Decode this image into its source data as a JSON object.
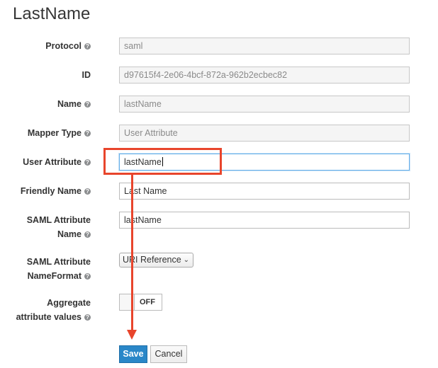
{
  "page": {
    "title": "LastName"
  },
  "fields": {
    "protocol": {
      "label": "Protocol",
      "value": "saml"
    },
    "id": {
      "label": "ID",
      "value": "d97615f4-2e06-4bcf-872a-962b2ecbec82"
    },
    "name": {
      "label": "Name",
      "value": "lastName"
    },
    "mapper_type": {
      "label": "Mapper Type",
      "value": "User Attribute"
    },
    "user_attribute": {
      "label": "User Attribute",
      "value": "lastName"
    },
    "friendly_name": {
      "label": "Friendly Name",
      "value": "Last Name"
    },
    "saml_attribute_name": {
      "label_line1": "SAML Attribute",
      "label_line2": "Name",
      "value": "lastName"
    },
    "saml_attribute_nameformat": {
      "label_line1": "SAML Attribute",
      "label_line2": "NameFormat",
      "selected": "URI Reference"
    },
    "aggregate": {
      "label_line1": "Aggregate",
      "label_line2": "attribute values",
      "state": "OFF"
    }
  },
  "buttons": {
    "save": "Save",
    "cancel": "Cancel"
  },
  "help_icon_glyph": "?",
  "colors": {
    "annotation": "#e8452c",
    "primary_button": "#2a87c8"
  }
}
